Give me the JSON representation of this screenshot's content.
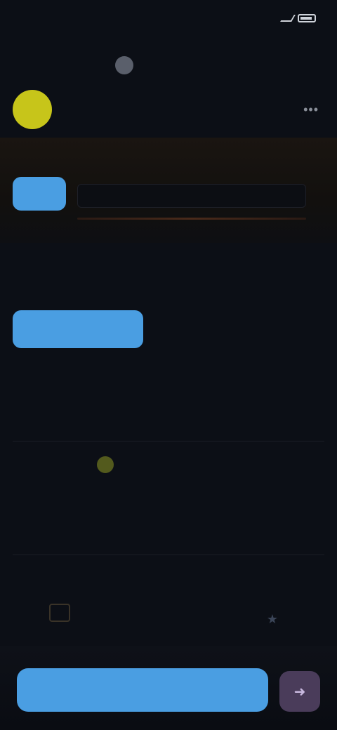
{
  "status_bar": {
    "time": ""
  },
  "header": {
    "title_part1": "",
    "title_part2": ""
  },
  "account": {
    "name": ""
  },
  "plan": {
    "section_title": "",
    "chip_label": "",
    "strip_items": [
      "",
      "",
      "",
      ""
    ]
  },
  "actions": {
    "section_title": "",
    "primary_label": "",
    "side_link": "",
    "grid": [
      "",
      "",
      "",
      ""
    ]
  },
  "details": {
    "section_title": "",
    "badge": "",
    "line1": "",
    "line2": ""
  },
  "extras": {
    "section_title": ""
  },
  "bottom": {
    "main_button": "",
    "side_button_icon": "arrow-icon"
  },
  "colors": {
    "background": "#0c0f16",
    "accent_blue": "#4a9ee2",
    "avatar_yellow": "#c7c51a",
    "side_button": "#4a3c5a"
  }
}
